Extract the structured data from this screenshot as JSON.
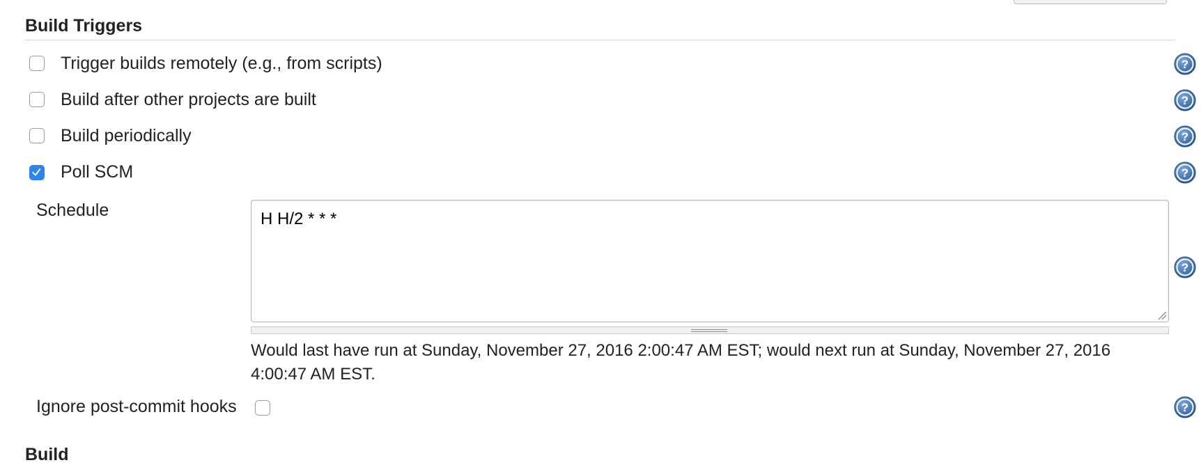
{
  "sections": {
    "build_triggers_title": "Build Triggers",
    "build_title": "Build"
  },
  "triggers": [
    {
      "label": "Trigger builds remotely (e.g., from scripts)",
      "checked": false
    },
    {
      "label": "Build after other projects are built",
      "checked": false
    },
    {
      "label": "Build periodically",
      "checked": false
    },
    {
      "label": "Poll SCM",
      "checked": true
    }
  ],
  "poll_scm": {
    "schedule_label": "Schedule",
    "schedule_value": "H H/2 * * *",
    "validation_message": "Would last have run at Sunday, November 27, 2016 2:00:47 AM EST; would next run at Sunday, November 27, 2016 4:00:47 AM EST.",
    "ignore_hooks_label": "Ignore post-commit hooks",
    "ignore_hooks_checked": false
  },
  "icons": {
    "help": "help-icon",
    "checkmark": "checkmark-icon",
    "resize": "resize-grip-icon"
  },
  "colors": {
    "accent": "#2f86e6",
    "help_icon": "#2e5f9e",
    "rule": "#d4d4d4"
  }
}
